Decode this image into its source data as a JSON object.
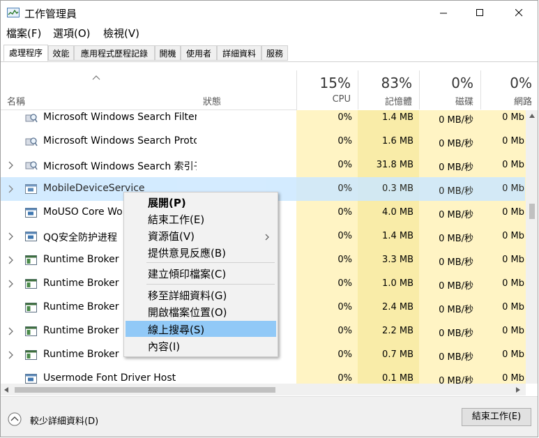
{
  "window": {
    "title": "工作管理員"
  },
  "menu": [
    "檔案(F)",
    "選項(O)",
    "檢視(V)"
  ],
  "tabs": [
    "處理程序",
    "效能",
    "應用程式歷程記錄",
    "開機",
    "使用者",
    "詳細資料",
    "服務"
  ],
  "columns": {
    "name": "名稱",
    "status": "狀態",
    "cpu": {
      "pct": "15%",
      "label": "CPU"
    },
    "mem": {
      "pct": "83%",
      "label": "記憶體"
    },
    "disk": {
      "pct": "0%",
      "label": "磁碟"
    },
    "net": {
      "pct": "0%",
      "label": "網路"
    }
  },
  "rows": [
    {
      "name": "Microsoft Windows Search Filter ...",
      "cpu": "0%",
      "mem": "1.4 MB",
      "disk": "0 MB/秒",
      "net": "0 Mb",
      "icon": "search-process-icon",
      "expandable": false
    },
    {
      "name": "Microsoft Windows Search Protoc...",
      "cpu": "0%",
      "mem": "1.6 MB",
      "disk": "0 MB/秒",
      "net": "0 Mb",
      "icon": "search-process-icon",
      "expandable": false
    },
    {
      "name": "Microsoft Windows Search 索引子",
      "cpu": "0%",
      "mem": "31.8 MB",
      "disk": "0 MB/秒",
      "net": "0 Mb",
      "icon": "search-process-icon",
      "expandable": true
    },
    {
      "name": "MobileDeviceService",
      "cpu": "0%",
      "mem": "0.3 MB",
      "disk": "0 MB/秒",
      "net": "0 Mb",
      "icon": "service-icon",
      "expandable": true,
      "selected": true
    },
    {
      "name": "MoUSO Core Worker",
      "cpu": "0%",
      "mem": "4.0 MB",
      "disk": "0 MB/秒",
      "net": "0 Mb",
      "icon": "service-icon",
      "expandable": false
    },
    {
      "name": "QQ安全防护进程（Q",
      "cpu": "0%",
      "mem": "1.4 MB",
      "disk": "0 MB/秒",
      "net": "0 Mb",
      "icon": "service-icon",
      "expandable": true
    },
    {
      "name": "Runtime Broker",
      "cpu": "0%",
      "mem": "3.3 MB",
      "disk": "0 MB/秒",
      "net": "0 Mb",
      "icon": "app-window-icon",
      "expandable": true
    },
    {
      "name": "Runtime Broker",
      "cpu": "0%",
      "mem": "1.0 MB",
      "disk": "0 MB/秒",
      "net": "0 Mb",
      "icon": "app-window-icon",
      "expandable": true
    },
    {
      "name": "Runtime Broker",
      "cpu": "0%",
      "mem": "2.4 MB",
      "disk": "0 MB/秒",
      "net": "0 Mb",
      "icon": "app-window-icon",
      "expandable": false
    },
    {
      "name": "Runtime Broker",
      "cpu": "0%",
      "mem": "2.2 MB",
      "disk": "0 MB/秒",
      "net": "0 Mb",
      "icon": "app-window-icon",
      "expandable": true
    },
    {
      "name": "Runtime Broker",
      "cpu": "0%",
      "mem": "0.7 MB",
      "disk": "0 MB/秒",
      "net": "0 Mb",
      "icon": "app-window-icon",
      "expandable": true
    },
    {
      "name": "Usermode Font Driver Host",
      "cpu": "0%",
      "mem": "0.1 MB",
      "disk": "0 MB/秒",
      "net": "0 Mb",
      "icon": "service-icon",
      "expandable": false
    }
  ],
  "context_menu": {
    "items": [
      {
        "label": "展開(P)",
        "bold": true
      },
      {
        "label": "結束工作(E)"
      },
      {
        "label": "資源值(V)",
        "submenu": true
      },
      {
        "label": "提供意見反應(B)"
      },
      {
        "label": "建立傾印檔案(C)"
      },
      {
        "label": "移至詳細資料(G)"
      },
      {
        "label": "開啟檔案位置(O)"
      },
      {
        "label": "線上搜尋(S)",
        "highlighted": true
      },
      {
        "label": "內容(I)"
      }
    ]
  },
  "bottom": {
    "fewer_details": "較少詳細資料(D)",
    "end_task": "結束工作(E)"
  },
  "colors": {
    "heat_yellow": "#fff4c4",
    "heat_yellow_dark": "#f9eca8",
    "selection": "#cce8ff",
    "menu_highlight": "#91c9f7"
  }
}
